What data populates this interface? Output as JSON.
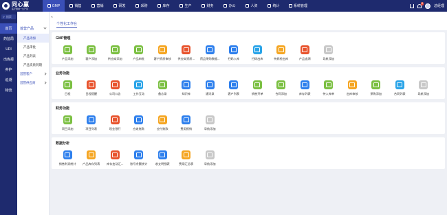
{
  "brand": {
    "name": "同心赢",
    "sub": "医疗器械一生产营"
  },
  "topnav": [
    {
      "label": "GMP",
      "active": true
    },
    {
      "label": "销售"
    },
    {
      "label": "营销"
    },
    {
      "label": "研发"
    },
    {
      "label": "采购"
    },
    {
      "label": "库存"
    },
    {
      "label": "生产"
    },
    {
      "label": "财务"
    },
    {
      "label": "办公"
    },
    {
      "label": "人资"
    },
    {
      "label": "统计"
    },
    {
      "label": "系统管理"
    }
  ],
  "user": {
    "name": "总经理",
    "notifications": "8"
  },
  "rail": {
    "search_placeholder": "搜索",
    "items": [
      {
        "label": "首页",
        "active": true
      },
      {
        "label": "药监局"
      },
      {
        "label": "UDI"
      },
      {
        "label": "出库报"
      },
      {
        "label": "养护"
      },
      {
        "label": "追溯"
      },
      {
        "label": "物流"
      }
    ]
  },
  "submenu": {
    "header": "首营产品",
    "items": [
      {
        "label": "产品添加",
        "active": true
      },
      {
        "label": "产品审批"
      },
      {
        "label": "产品列表"
      },
      {
        "label": "产品资质到期"
      }
    ],
    "groups": [
      "首营客户",
      "首营供应商"
    ]
  },
  "tab": "个性化工作台",
  "sections": [
    {
      "title": "GMP管理",
      "items": [
        {
          "label": "产品添加",
          "color": "#7cc043"
        },
        {
          "label": "客户添加",
          "color": "#7cc043"
        },
        {
          "label": "供应商添加",
          "color": "#7cc043"
        },
        {
          "label": "产品审批",
          "color": "#7cc043"
        },
        {
          "label": "客户资质审核",
          "color": "#f5a623"
        },
        {
          "label": "供应商资质...",
          "color": "#e8542e"
        },
        {
          "label": "药品采购数据...",
          "color": "#2f80ed"
        },
        {
          "label": "扫码入库",
          "color": "#2f80ed"
        },
        {
          "label": "扫码出库",
          "color": "#2aa4e8"
        },
        {
          "label": "待质检出库",
          "color": "#f5a623"
        },
        {
          "label": "产品追溯",
          "color": "#e8542e"
        },
        {
          "label": "导航添加",
          "color": "#c8c8c8"
        }
      ]
    },
    {
      "title": "业务功能",
      "items": [
        {
          "label": "日程",
          "color": "#7cc043"
        },
        {
          "label": "日程提醒",
          "color": "#e8542e"
        },
        {
          "label": "公司公告",
          "color": "#e8542e"
        },
        {
          "label": "工作互动",
          "color": "#2aa4e8"
        },
        {
          "label": "备忘录",
          "color": "#7cc043"
        },
        {
          "label": "知识库",
          "color": "#2f80ed"
        },
        {
          "label": "通讯录",
          "color": "#2f80ed"
        },
        {
          "label": "客户列表",
          "color": "#2f80ed"
        },
        {
          "label": "销售开单",
          "color": "#7cc043"
        },
        {
          "label": "合同添加",
          "color": "#7cc043"
        },
        {
          "label": "库存列表",
          "color": "#2f80ed"
        },
        {
          "label": "待入库单",
          "color": "#7cc043"
        },
        {
          "label": "出库审核",
          "color": "#f5a623"
        },
        {
          "label": "采购添加",
          "color": "#7cc043"
        },
        {
          "label": "合同列表",
          "color": "#2aa4e8"
        },
        {
          "label": "导航添加",
          "color": "#c8c8c8"
        }
      ]
    },
    {
      "title": "财务功能",
      "items": [
        {
          "label": "项目添加",
          "color": "#7cc043"
        },
        {
          "label": "项目列表",
          "color": "#2f80ed"
        },
        {
          "label": "现金银行",
          "color": "#e8542e"
        },
        {
          "label": "应收账款",
          "color": "#2f80ed"
        },
        {
          "label": "应付账款",
          "color": "#f5a623"
        },
        {
          "label": "费用报销",
          "color": "#2f80ed"
        },
        {
          "label": "导航添加",
          "color": "#c8c8c8"
        }
      ]
    },
    {
      "title": "数据分析",
      "items": [
        {
          "label": "销售利润统计",
          "color": "#2f80ed"
        },
        {
          "label": "产品库存列表",
          "color": "#f5a623"
        },
        {
          "label": "库存变动汇...",
          "color": "#e8542e"
        },
        {
          "label": "账号余额统计",
          "color": "#2f80ed"
        },
        {
          "label": "收支明细表",
          "color": "#2f80ed"
        },
        {
          "label": "费用汇总表",
          "color": "#f5a623"
        },
        {
          "label": "导航添加",
          "color": "#c8c8c8"
        }
      ]
    }
  ]
}
